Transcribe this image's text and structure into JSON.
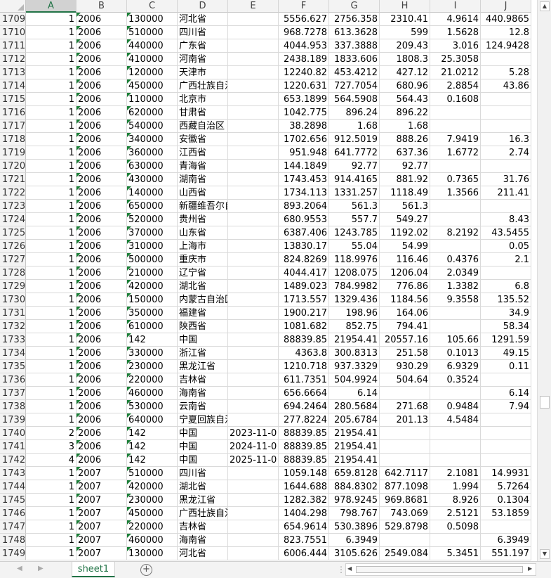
{
  "columns": [
    "A",
    "B",
    "C",
    "D",
    "E",
    "F",
    "G",
    "H",
    "I",
    "J"
  ],
  "selected_column": "A",
  "rows": [
    [
      "1709",
      "1",
      "2006",
      "130000",
      "河北省",
      "",
      "5556.627",
      "2756.358",
      "2310.41",
      "4.9614",
      "440.9865"
    ],
    [
      "1710",
      "1",
      "2006",
      "510000",
      "四川省",
      "",
      "968.7278",
      "613.3628",
      "599",
      "1.5628",
      "12.8"
    ],
    [
      "1711",
      "1",
      "2006",
      "440000",
      "广东省",
      "",
      "4044.953",
      "337.3888",
      "209.43",
      "3.016",
      "124.9428"
    ],
    [
      "1712",
      "1",
      "2006",
      "410000",
      "河南省",
      "",
      "2438.189",
      "1833.606",
      "1808.3",
      "25.3058",
      ""
    ],
    [
      "1713",
      "1",
      "2006",
      "120000",
      "天津市",
      "",
      "12240.82",
      "453.4212",
      "427.12",
      "21.0212",
      "5.28"
    ],
    [
      "1714",
      "1",
      "2006",
      "450000",
      "广西壮族自治区",
      "",
      "1220.631",
      "727.7054",
      "680.96",
      "2.8854",
      "43.86"
    ],
    [
      "1715",
      "1",
      "2006",
      "110000",
      "北京市",
      "",
      "653.1899",
      "564.5908",
      "564.43",
      "0.1608",
      ""
    ],
    [
      "1716",
      "1",
      "2006",
      "620000",
      "甘肃省",
      "",
      "1042.775",
      "896.24",
      "896.22",
      "",
      ""
    ],
    [
      "1717",
      "1",
      "2006",
      "540000",
      "西藏自治区",
      "",
      "38.2898",
      "1.68",
      "1.68",
      "",
      ""
    ],
    [
      "1718",
      "1",
      "2006",
      "340000",
      "安徽省",
      "",
      "1702.656",
      "912.5019",
      "888.26",
      "7.9419",
      "16.3"
    ],
    [
      "1719",
      "1",
      "2006",
      "360000",
      "江西省",
      "",
      "951.948",
      "641.7772",
      "637.36",
      "1.6772",
      "2.74"
    ],
    [
      "1720",
      "1",
      "2006",
      "630000",
      "青海省",
      "",
      "144.1849",
      "92.77",
      "92.77",
      "",
      ""
    ],
    [
      "1721",
      "1",
      "2006",
      "430000",
      "湖南省",
      "",
      "1743.453",
      "914.4165",
      "881.92",
      "0.7365",
      "31.76"
    ],
    [
      "1722",
      "1",
      "2006",
      "140000",
      "山西省",
      "",
      "1734.113",
      "1331.257",
      "1118.49",
      "1.3566",
      "211.41"
    ],
    [
      "1723",
      "1",
      "2006",
      "650000",
      "新疆维吾尔自治区",
      "",
      "893.2064",
      "561.3",
      "561.3",
      "",
      ""
    ],
    [
      "1724",
      "1",
      "2006",
      "520000",
      "贵州省",
      "",
      "680.9553",
      "557.7",
      "549.27",
      "",
      "8.43"
    ],
    [
      "1725",
      "1",
      "2006",
      "370000",
      "山东省",
      "",
      "6387.406",
      "1243.785",
      "1192.02",
      "8.2192",
      "43.5455"
    ],
    [
      "1726",
      "1",
      "2006",
      "310000",
      "上海市",
      "",
      "13830.17",
      "55.04",
      "54.99",
      "",
      "0.05"
    ],
    [
      "1727",
      "1",
      "2006",
      "500000",
      "重庆市",
      "",
      "824.8269",
      "118.9976",
      "116.46",
      "0.4376",
      "2.1"
    ],
    [
      "1728",
      "1",
      "2006",
      "210000",
      "辽宁省",
      "",
      "4044.417",
      "1208.075",
      "1206.04",
      "2.0349",
      ""
    ],
    [
      "1729",
      "1",
      "2006",
      "420000",
      "湖北省",
      "",
      "1489.023",
      "784.9982",
      "776.86",
      "1.3382",
      "6.8"
    ],
    [
      "1730",
      "1",
      "2006",
      "150000",
      "内蒙古自治区",
      "",
      "1713.557",
      "1329.436",
      "1184.56",
      "9.3558",
      "135.52"
    ],
    [
      "1731",
      "1",
      "2006",
      "350000",
      "福建省",
      "",
      "1900.217",
      "198.96",
      "164.06",
      "",
      "34.9"
    ],
    [
      "1732",
      "1",
      "2006",
      "610000",
      "陕西省",
      "",
      "1081.682",
      "852.75",
      "794.41",
      "",
      "58.34"
    ],
    [
      "1733",
      "1",
      "2006",
      "142",
      "中国",
      "",
      "88839.85",
      "21954.41",
      "20557.16",
      "105.66",
      "1291.59"
    ],
    [
      "1734",
      "1",
      "2006",
      "330000",
      "浙江省",
      "",
      "4363.8",
      "300.8313",
      "251.58",
      "0.1013",
      "49.15"
    ],
    [
      "1735",
      "1",
      "2006",
      "230000",
      "黑龙江省",
      "",
      "1210.718",
      "937.3329",
      "930.29",
      "6.9329",
      "0.11"
    ],
    [
      "1736",
      "1",
      "2006",
      "220000",
      "吉林省",
      "",
      "611.7351",
      "504.9924",
      "504.64",
      "0.3524",
      ""
    ],
    [
      "1737",
      "1",
      "2006",
      "460000",
      "海南省",
      "",
      "656.6664",
      "6.14",
      "",
      "",
      "6.14"
    ],
    [
      "1738",
      "1",
      "2006",
      "530000",
      "云南省",
      "",
      "694.2464",
      "280.5684",
      "271.68",
      "0.9484",
      "7.94"
    ],
    [
      "1739",
      "1",
      "2006",
      "640000",
      "宁夏回族自治区",
      "",
      "277.8224",
      "205.6784",
      "201.13",
      "4.5484",
      ""
    ],
    [
      "1740",
      "2",
      "2006",
      "142",
      "中国",
      "2023-11-0",
      "88839.85",
      "21954.41",
      "",
      "",
      ""
    ],
    [
      "1741",
      "3",
      "2006",
      "142",
      "中国",
      "2024-11-0",
      "88839.85",
      "21954.41",
      "",
      "",
      ""
    ],
    [
      "1742",
      "4",
      "2006",
      "142",
      "中国",
      "2025-11-0",
      "88839.85",
      "21954.41",
      "",
      "",
      ""
    ],
    [
      "1743",
      "1",
      "2007",
      "510000",
      "四川省",
      "",
      "1059.148",
      "659.8128",
      "642.7117",
      "2.1081",
      "14.9931"
    ],
    [
      "1744",
      "1",
      "2007",
      "420000",
      "湖北省",
      "",
      "1644.688",
      "884.8302",
      "877.1098",
      "1.994",
      "5.7264"
    ],
    [
      "1745",
      "1",
      "2007",
      "230000",
      "黑龙江省",
      "",
      "1282.382",
      "978.9245",
      "969.8681",
      "8.926",
      "0.1304"
    ],
    [
      "1746",
      "1",
      "2007",
      "450000",
      "广西壮族自治区",
      "",
      "1404.298",
      "798.767",
      "743.069",
      "2.5121",
      "53.1859"
    ],
    [
      "1747",
      "1",
      "2007",
      "220000",
      "吉林省",
      "",
      "654.9614",
      "530.3896",
      "529.8798",
      "0.5098",
      ""
    ],
    [
      "1748",
      "1",
      "2007",
      "460000",
      "海南省",
      "",
      "823.7551",
      "6.3949",
      "",
      "",
      "6.3949"
    ],
    [
      "1749",
      "1",
      "2007",
      "130000",
      "河北省",
      "",
      "6006.444",
      "3105.626",
      "2549.084",
      "5.3451",
      "551.197"
    ]
  ],
  "sheet_tab": "sheet1",
  "add_sheet_label": "+",
  "scroll": {
    "up": "▲",
    "down": "▼",
    "left": "◀",
    "right": "▶"
  },
  "tab_nav": {
    "prev": "◀",
    "next": "▶"
  },
  "hscroll_separator": "⋮"
}
